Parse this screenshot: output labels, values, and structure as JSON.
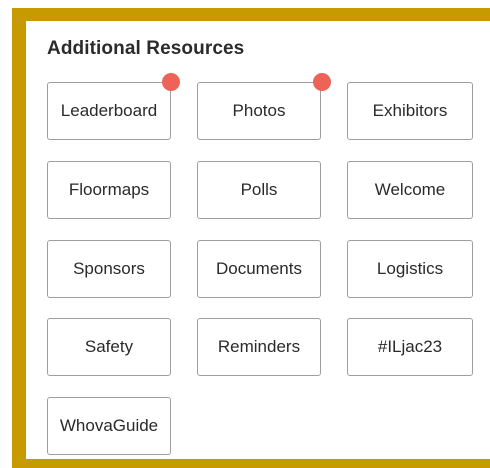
{
  "section": {
    "title": "Additional Resources"
  },
  "tiles": [
    {
      "label": "Leaderboard",
      "has_badge": true
    },
    {
      "label": "Photos",
      "has_badge": true
    },
    {
      "label": "Exhibitors",
      "has_badge": false
    },
    {
      "label": "Floormaps",
      "has_badge": false
    },
    {
      "label": "Polls",
      "has_badge": false
    },
    {
      "label": "Welcome",
      "has_badge": false
    },
    {
      "label": "Sponsors",
      "has_badge": false
    },
    {
      "label": "Documents",
      "has_badge": false
    },
    {
      "label": "Logistics",
      "has_badge": false
    },
    {
      "label": "Safety",
      "has_badge": false
    },
    {
      "label": "Reminders",
      "has_badge": false
    },
    {
      "label": "#ILjac23",
      "has_badge": false
    },
    {
      "label": "WhovaGuide",
      "has_badge": false
    }
  ],
  "colors": {
    "frame_accent": "#C69A00",
    "badge": "#EE6358",
    "tile_border": "#9E9E9E",
    "text": "#2A2A2A"
  }
}
